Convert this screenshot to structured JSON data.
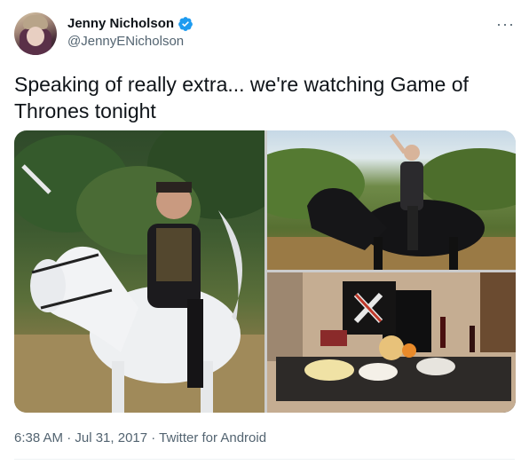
{
  "author": {
    "display_name": "Jenny Nicholson",
    "handle": "@JennyENicholson",
    "verified": true,
    "badge_color": "#1d9bf0"
  },
  "tweet": {
    "text": "Speaking of really extra... we're watching Game of Thrones tonight",
    "timestamp": "6:38 AM · Jul 31, 2017 · ",
    "source": "Twitter for Android"
  },
  "media": {
    "images": [
      "knight-on-white-horse",
      "rider-on-black-horse",
      "themed-food-table"
    ]
  },
  "icons": {
    "more": "more-horizontal-icon",
    "verified": "verified-badge-icon"
  },
  "colors": {
    "text_primary": "#0f1419",
    "text_secondary": "#536471",
    "accent": "#1d9bf0"
  }
}
